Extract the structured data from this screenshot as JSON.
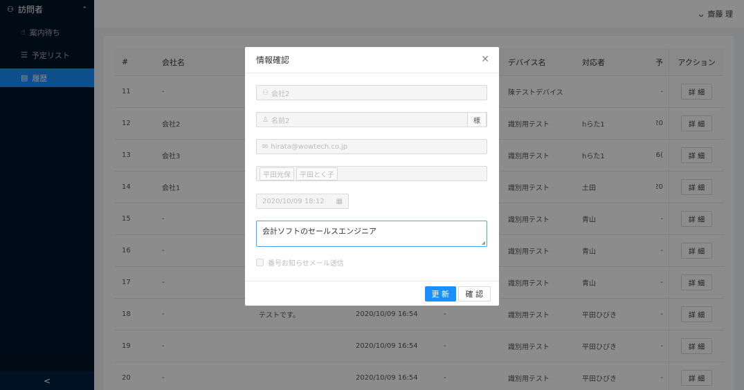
{
  "sidebar": {
    "group_label": "訪問者",
    "items": [
      {
        "label": "案内待ち",
        "icon": "hand-icon"
      },
      {
        "label": "予定リスト",
        "icon": "list-icon"
      },
      {
        "label": "履歴",
        "icon": "history-icon"
      }
    ],
    "collapse_glyph": "<"
  },
  "header": {
    "user_name": "齋藤 理"
  },
  "table": {
    "headers": {
      "num": "#",
      "company": "会社名",
      "device": "デバイス名",
      "handler": "対応者",
      "reserve": "予",
      "action": "アクション"
    },
    "rows": [
      {
        "num": "11",
        "company": "-",
        "purpose": "",
        "date": "",
        "extra": "",
        "device": "陳テストデバイス",
        "handler": "",
        "reserve": "-",
        "action": "詳 細"
      },
      {
        "num": "12",
        "company": "会社2",
        "purpose": "",
        "date": "",
        "extra": "",
        "device": "識別用テスト",
        "handler": "hらた1",
        "reserve": "20",
        "action": "詳 細"
      },
      {
        "num": "13",
        "company": "会社3",
        "purpose": "",
        "date": "",
        "extra": "",
        "device": "識別用テスト",
        "handler": "hらた1",
        "reserve": "6(",
        "action": "詳 細"
      },
      {
        "num": "14",
        "company": "会社1",
        "purpose": "",
        "date": "",
        "extra": "",
        "device": "識別用テスト",
        "handler": "土田",
        "reserve": "20",
        "action": "詳 細"
      },
      {
        "num": "15",
        "company": "-",
        "purpose": "",
        "date": "",
        "extra": "",
        "device": "識別用テスト",
        "handler": "青山",
        "reserve": "-",
        "action": "詳 細"
      },
      {
        "num": "16",
        "company": "-",
        "purpose": "",
        "date": "",
        "extra": "",
        "device": "識別用テスト",
        "handler": "青山",
        "reserve": "-",
        "action": "詳 細"
      },
      {
        "num": "17",
        "company": "-",
        "purpose": "",
        "date": "",
        "extra": "",
        "device": "識別用テスト",
        "handler": "青山",
        "reserve": "-",
        "action": "詳 細"
      },
      {
        "num": "18",
        "company": "-",
        "purpose": "テストです。",
        "date": "2020/10/09 16:54",
        "extra": "-",
        "device": "識別用テスト",
        "handler": "平田ひびき",
        "reserve": "-",
        "action": "詳 細"
      },
      {
        "num": "19",
        "company": "-",
        "purpose": "",
        "date": "2020/10/09 16:54",
        "extra": "-",
        "device": "識別用テスト",
        "handler": "平田ひびき",
        "reserve": "-",
        "action": "詳 細"
      },
      {
        "num": "20",
        "company": "-",
        "purpose": "",
        "date": "2020/10/09 16:54",
        "extra": "-",
        "device": "識別用テスト",
        "handler": "平田ひびき",
        "reserve": "-",
        "action": "詳 細"
      }
    ]
  },
  "modal": {
    "title": "情報確認",
    "company_placeholder": "会社2",
    "name_placeholder": "名前2",
    "name_suffix": "様",
    "email": "hirata@wowtech.co.jp",
    "tags": [
      "平田光保",
      "平田とく子"
    ],
    "datetime": "2020/10/09 18:12",
    "purpose": "会計ソフトのセールスエンジニア",
    "checkbox_label": "番号お知らせメール送信",
    "update_label": "更 新",
    "confirm_label": "確 認"
  }
}
